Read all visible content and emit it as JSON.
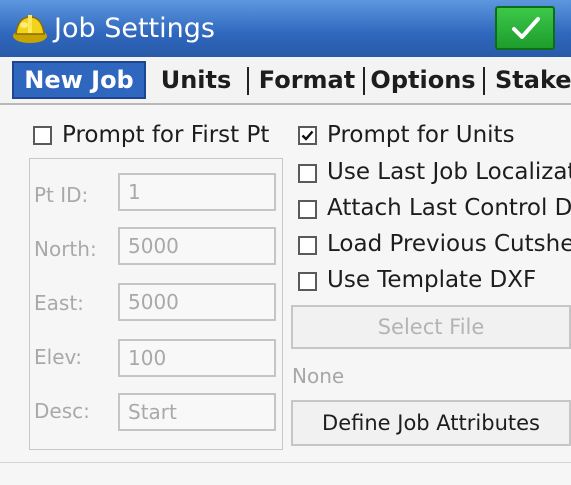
{
  "window": {
    "title": "Job Settings",
    "ok_icon": "checkmark-icon",
    "app_icon": "hardhat-icon"
  },
  "tabs": [
    {
      "label": "New Job",
      "active": true
    },
    {
      "label": "Units",
      "active": false
    },
    {
      "label": "Format",
      "active": false
    },
    {
      "label": "Options",
      "active": false
    },
    {
      "label": "Stake",
      "active": false
    }
  ],
  "prompt_first_pt": {
    "label": "Prompt for First Pt",
    "checked": false
  },
  "fields": {
    "pt_id": {
      "label": "Pt ID:",
      "value": "1"
    },
    "north": {
      "label": "North:",
      "value": "5000"
    },
    "east": {
      "label": "East:",
      "value": "5000"
    },
    "elev": {
      "label": "Elev:",
      "value": "100"
    },
    "desc": {
      "label": "Desc:",
      "value": "Start"
    }
  },
  "options": [
    {
      "label": "Prompt for Units",
      "checked": true
    },
    {
      "label": "Use Last Job Localizat",
      "checked": false
    },
    {
      "label": "Attach Last Control Da",
      "checked": false
    },
    {
      "label": "Load Previous Cutshe",
      "checked": false
    },
    {
      "label": "Use Template DXF",
      "checked": false
    }
  ],
  "select_file_label": "Select File",
  "file_status": "None",
  "define_attributes_label": "Define Job Attributes",
  "colors": {
    "titlebar": "#2f67bd",
    "active_tab": "#2f66be",
    "ok_button": "#1e9d2c",
    "disabled_text": "#a9a9a9"
  }
}
